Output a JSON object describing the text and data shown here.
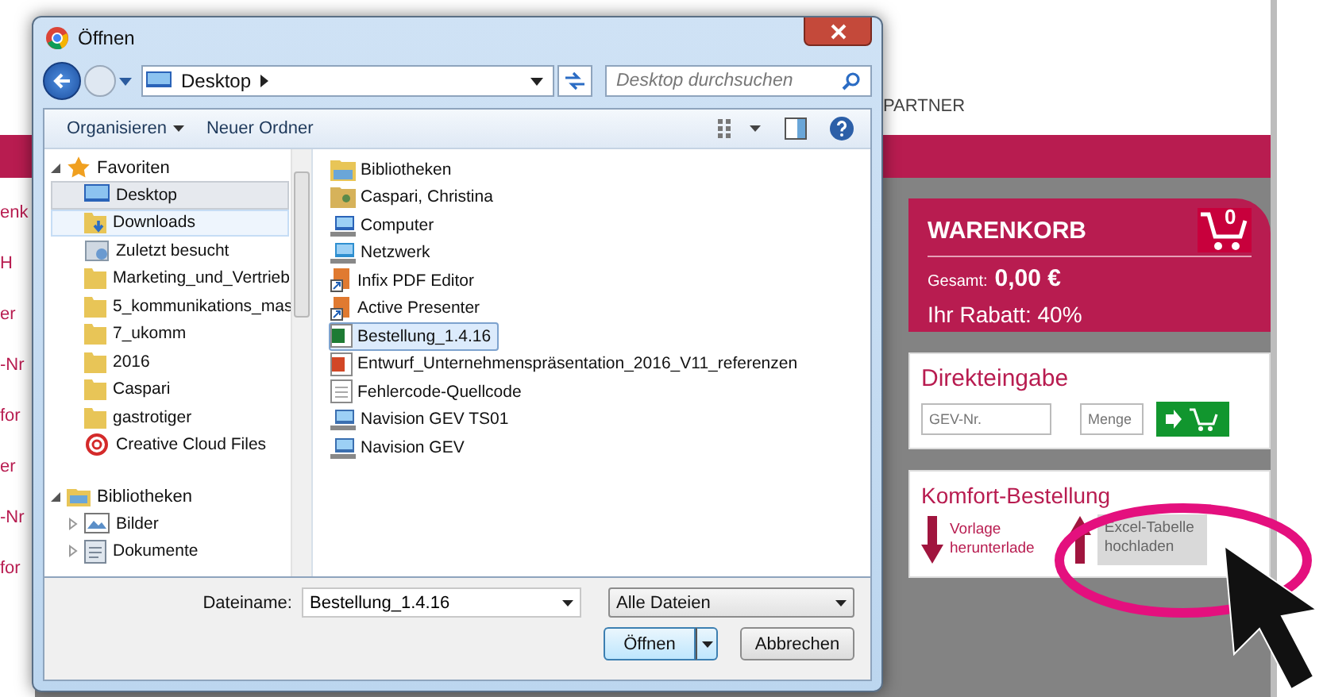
{
  "page": {
    "nav_label": "PARTNER",
    "left_fragments": [
      "enk",
      "H",
      "er",
      "-Nr",
      "for",
      "er",
      "-Nr",
      "for"
    ]
  },
  "cart": {
    "title": "WARENKORB",
    "count": "0",
    "total_label": "Gesamt:",
    "total": "0,00 €",
    "discount": "Ihr Rabatt: 40%"
  },
  "direct_entry": {
    "title": "Direkteingabe",
    "fields": [
      {
        "placeholder": "GEV-Nr."
      },
      {
        "placeholder": "Menge"
      }
    ]
  },
  "comfort_order": {
    "title": "Komfort-Bestellung",
    "actions": [
      {
        "kind": "download",
        "lines": [
          "Vorlage",
          "herunterlade"
        ]
      },
      {
        "kind": "upload",
        "lines": [
          "Excel-Tabelle",
          "hochladen"
        ]
      }
    ]
  },
  "dialog": {
    "title": "Öffnen",
    "address": "Desktop",
    "search": {
      "placeholder": "Desktop durchsuchen"
    },
    "toolbar": [
      "Organisieren",
      "Neuer Ordner"
    ],
    "nav": [
      {
        "label": "Favoriten",
        "kind": "star",
        "expanded": true,
        "children": [
          {
            "label": "Desktop",
            "kind": "desktop",
            "selected": true,
            "hovered": false
          },
          {
            "label": "Downloads",
            "kind": "download",
            "selected": false,
            "hovered": true
          },
          {
            "label": "Zuletzt besucht",
            "kind": "recent",
            "selected": false,
            "hovered": false
          },
          {
            "label": "Marketing_und_Vertrieb",
            "kind": "folder",
            "selected": false,
            "hovered": false
          },
          {
            "label": "5_kommunikations_mas",
            "kind": "folder",
            "selected": false,
            "hovered": false
          },
          {
            "label": "7_ukomm",
            "kind": "folder",
            "selected": false,
            "hovered": false
          },
          {
            "label": "2016",
            "kind": "folder",
            "selected": false,
            "hovered": false
          },
          {
            "label": "Caspari",
            "kind": "folder",
            "selected": false,
            "hovered": false
          },
          {
            "label": "gastrotiger",
            "kind": "folder",
            "selected": false,
            "hovered": false
          },
          {
            "label": "Creative Cloud Files",
            "kind": "cloud",
            "selected": false,
            "hovered": false
          }
        ]
      },
      {
        "label": "Bibliotheken",
        "kind": "library",
        "expanded": true,
        "children": [
          {
            "label": "Bilder",
            "kind": "pictures",
            "expanded": false,
            "selected": false,
            "hovered": false
          },
          {
            "label": "Dokumente",
            "kind": "document",
            "expanded": false,
            "selected": false,
            "hovered": false
          }
        ]
      }
    ],
    "files": [
      {
        "name": "Bibliotheken",
        "kind": "library",
        "selected": false
      },
      {
        "name": "Caspari, Christina",
        "kind": "user",
        "selected": false
      },
      {
        "name": "Computer",
        "kind": "computer",
        "selected": false
      },
      {
        "name": "Netzwerk",
        "kind": "network",
        "selected": false
      },
      {
        "name": "Infix PDF Editor",
        "kind": "shortcut",
        "selected": false
      },
      {
        "name": "Active Presenter",
        "kind": "shortcut",
        "selected": false
      },
      {
        "name": "Bestellung_1.4.16",
        "kind": "excel",
        "selected": true
      },
      {
        "name": "Entwurf_Unternehmenspräsentation_2016_V11_referenzen",
        "kind": "powerpoint",
        "selected": false
      },
      {
        "name": "Fehlercode-Quellcode",
        "kind": "text",
        "selected": false
      },
      {
        "name": "Navision GEV TS01",
        "kind": "app",
        "selected": false
      },
      {
        "name": "Navision GEV",
        "kind": "app",
        "selected": false
      }
    ],
    "filename_label": "Dateiname:",
    "filename": "Bestellung_1.4.16",
    "filetype": "Alle Dateien",
    "buttons": [
      "Öffnen",
      "Abbrechen"
    ]
  }
}
